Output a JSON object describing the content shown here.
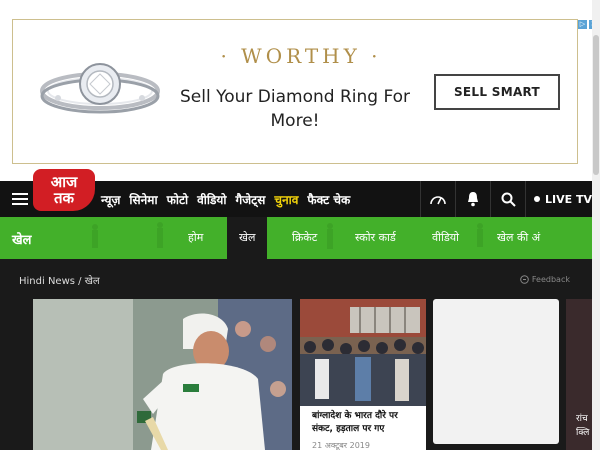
{
  "ad": {
    "brand": "WORTHY",
    "headline": "Sell Your Diamond Ring For More!",
    "cta": "SELL SMART",
    "adchoices": [
      "▷",
      "✕"
    ]
  },
  "logo": {
    "line1": "आज",
    "line2": "तक"
  },
  "nav": {
    "items": [
      "न्यूज़",
      "सिनेमा",
      "फोटो",
      "वीडियो",
      "गैजेट्स",
      "चुनाव",
      "फैक्ट चेक"
    ],
    "highlight_index": 5,
    "live_label": "LIVE TV"
  },
  "section": {
    "title": "खेल",
    "tabs": [
      "होम",
      "खेल",
      "क्रिकेट",
      "स्कोर कार्ड",
      "वीडियो",
      "खेल की अं"
    ],
    "active_index": 1
  },
  "breadcrumb": {
    "home": "Hindi News",
    "sep": "/",
    "current": "खेल"
  },
  "feedback": "Feedback",
  "cards": {
    "card2_title": "बांग्लादेश के भारत दौरे पर संकट, हड़ताल पर गए",
    "card2_date": "21 अक्टूबर 2019",
    "card4_lines": [
      "रांच",
      "क्लि"
    ]
  },
  "colors": {
    "brand_red": "#d21e24",
    "section_green": "#43b02a",
    "highlight_yellow": "#f2d30b"
  }
}
